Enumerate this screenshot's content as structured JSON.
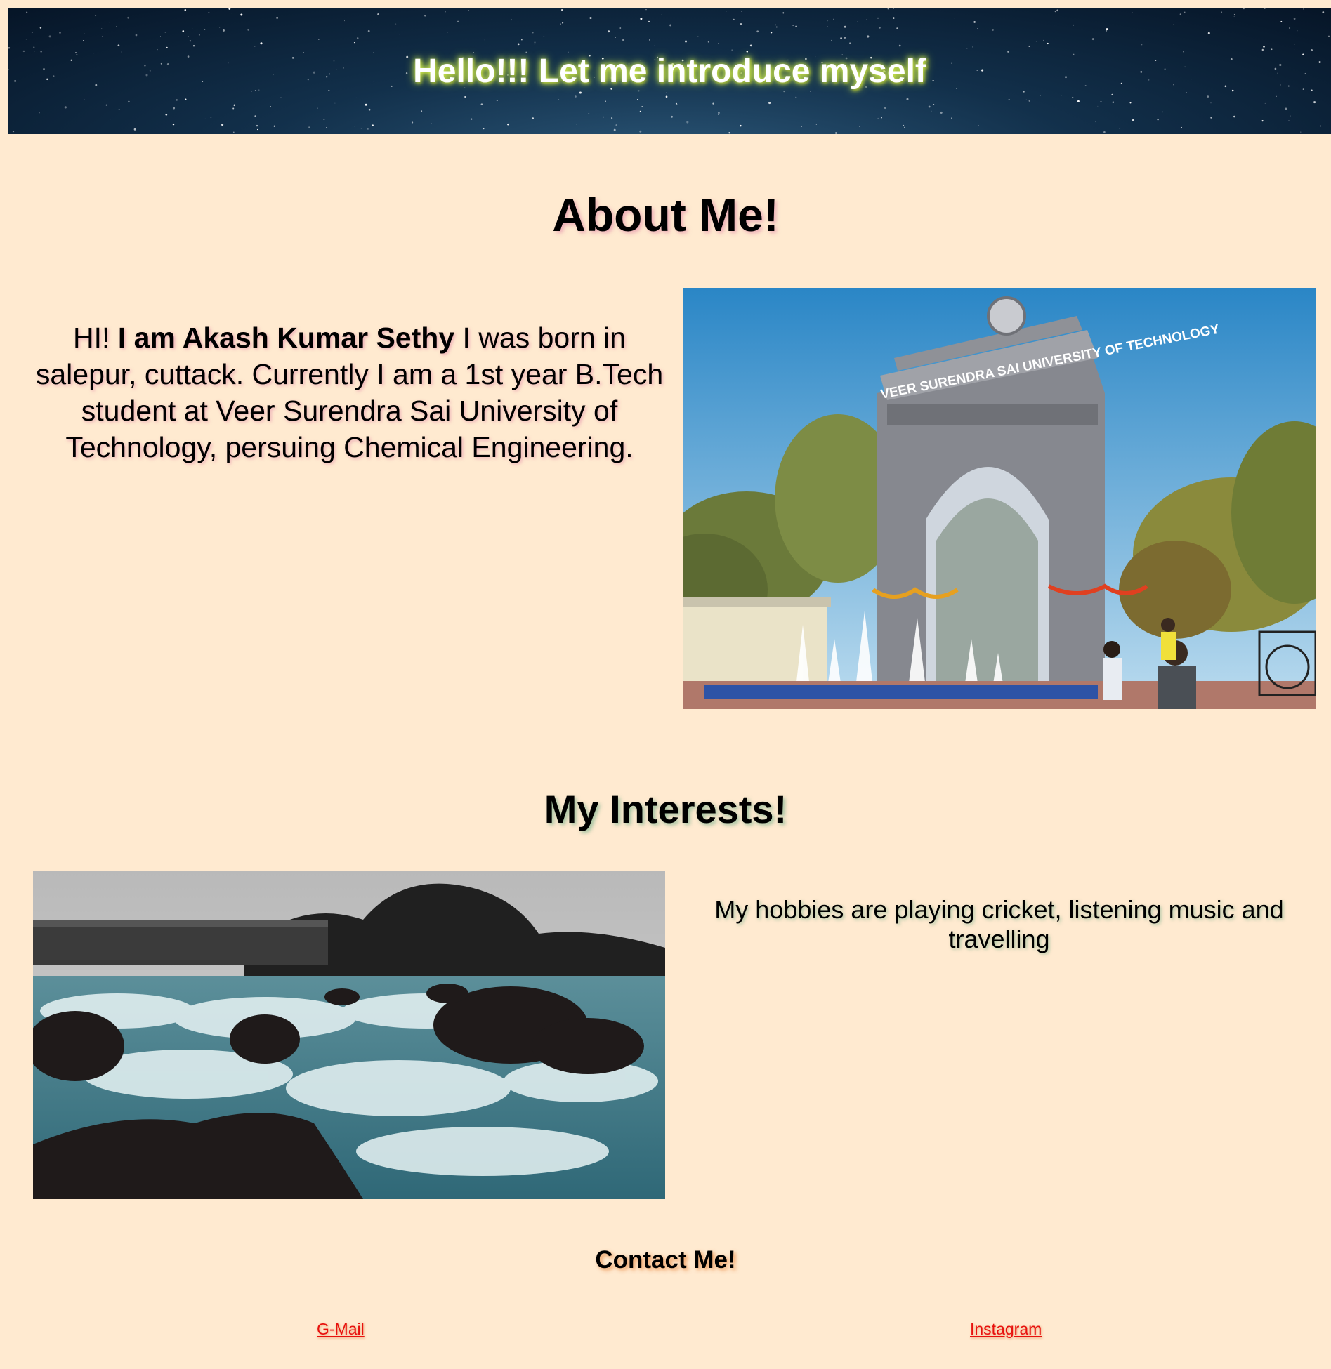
{
  "header": {
    "title": "Hello!!! Let me introduce myself"
  },
  "about": {
    "title": "About Me!",
    "text_pre": "HI! ",
    "text_bold": "I am Akash Kumar Sethy",
    "text_post": " I was born in salepur, cuttack. Currently I am a 1st year B.Tech student at Veer Surendra Sai University of Technology, persuing Chemical Engineering.",
    "gate_sign": "VEER SURENDRA SAI UNIVERSITY OF TECHNOLOGY"
  },
  "interests": {
    "title": "My Interests!",
    "text": "My hobbies are playing cricket, listening music and travelling"
  },
  "contact": {
    "title": "Contact Me!",
    "links": [
      {
        "label": "G-Mail"
      },
      {
        "label": "Instagram"
      }
    ]
  },
  "colors": {
    "page_background": "#ffead0",
    "link": "#e8110e",
    "header_glow": "#d8f45a"
  }
}
